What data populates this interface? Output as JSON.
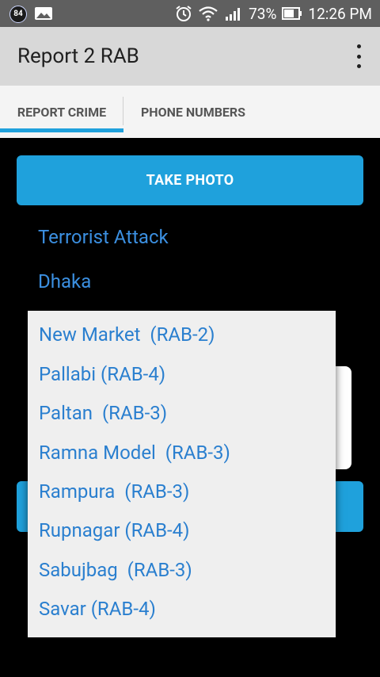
{
  "status_bar": {
    "badge": "84",
    "battery_percent": "73%",
    "time": "12:26 PM",
    "icons": [
      "alarm-icon",
      "wifi-icon",
      "signal-icon",
      "battery-icon"
    ]
  },
  "app_bar": {
    "title": "Report 2 RAB"
  },
  "tabs": [
    {
      "label": "REPORT CRIME",
      "selected": true
    },
    {
      "label": "PHONE NUMBERS",
      "selected": false
    }
  ],
  "form": {
    "take_photo_label": "TAKE PHOTO",
    "crime_type": "Terrorist Attack",
    "city": "Dhaka"
  },
  "dropdown": {
    "options": [
      "New Market  (RAB-2)",
      "Pallabi (RAB-4)",
      "Paltan  (RAB-3)",
      "Ramna Model  (RAB-3)",
      "Rampura  (RAB-3)",
      "Rupnagar (RAB-4)",
      "Sabujbag  (RAB-3)",
      "Savar (RAB-4)"
    ]
  },
  "colors": {
    "accent": "#1fa1dc",
    "link": "#2a7fcf"
  }
}
